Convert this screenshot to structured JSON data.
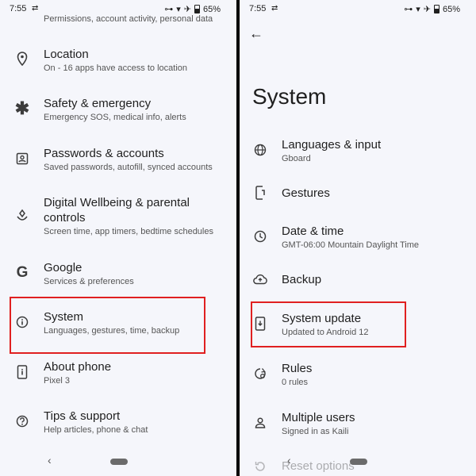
{
  "status": {
    "time": "7:55",
    "battery": "65%"
  },
  "left": {
    "top_partial": "Permissions, account activity, personal data",
    "items": [
      {
        "title": "Location",
        "subtitle": "On - 16 apps have access to location",
        "icon": "location-pin-icon"
      },
      {
        "title": "Safety & emergency",
        "subtitle": "Emergency SOS, medical info, alerts",
        "icon": "asterisk-icon"
      },
      {
        "title": "Passwords & accounts",
        "subtitle": "Saved passwords, autofill, synced accounts",
        "icon": "account-box-icon"
      },
      {
        "title_line1": "Digital Wellbeing & parental",
        "title_line2": "controls",
        "subtitle": "Screen time, app timers, bedtime schedules",
        "icon": "wellbeing-icon"
      },
      {
        "title": "Google",
        "subtitle": "Services & preferences",
        "icon": "google-g-icon"
      },
      {
        "title": "System",
        "subtitle": "Languages, gestures, time, backup",
        "icon": "info-icon"
      },
      {
        "title": "About phone",
        "subtitle": "Pixel 3",
        "icon": "phone-info-icon"
      },
      {
        "title": "Tips & support",
        "subtitle": "Help articles, phone & chat",
        "icon": "help-icon"
      }
    ]
  },
  "right": {
    "page_title": "System",
    "items": [
      {
        "title": "Languages & input",
        "subtitle": "Gboard",
        "icon": "globe-icon"
      },
      {
        "title": "Gestures",
        "subtitle": "",
        "icon": "gesture-phone-icon"
      },
      {
        "title": "Date & time",
        "subtitle": "GMT-06:00 Mountain Daylight Time",
        "icon": "clock-icon"
      },
      {
        "title": "Backup",
        "subtitle": "",
        "icon": "cloud-upload-icon"
      },
      {
        "title": "System update",
        "subtitle": "Updated to Android 12",
        "icon": "system-update-icon"
      },
      {
        "title": "Rules",
        "subtitle": "0 rules",
        "icon": "rules-icon"
      },
      {
        "title": "Multiple users",
        "subtitle": "Signed in as Kaili",
        "icon": "person-icon"
      },
      {
        "title": "Reset options",
        "subtitle": "",
        "icon": "reset-icon"
      }
    ]
  },
  "colors": {
    "highlight": "#e02020",
    "background": "#f5f6fb"
  }
}
